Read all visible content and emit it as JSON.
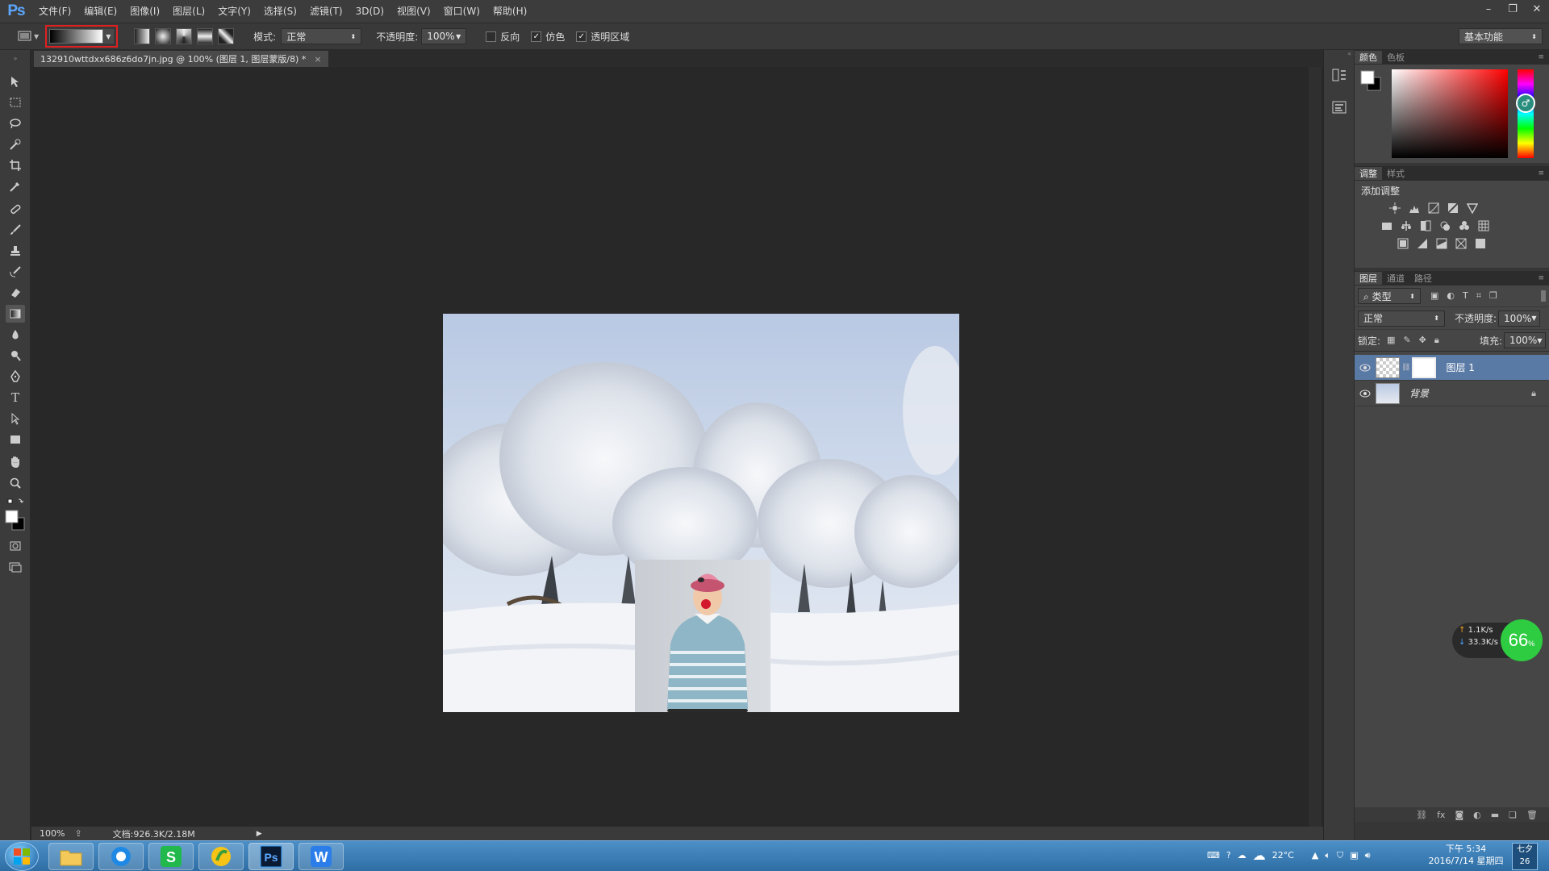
{
  "app": {
    "logo": "Ps"
  },
  "menu": [
    "文件(F)",
    "编辑(E)",
    "图像(I)",
    "图层(L)",
    "文字(Y)",
    "选择(S)",
    "滤镜(T)",
    "3D(D)",
    "视图(V)",
    "窗口(W)",
    "帮助(H)"
  ],
  "options": {
    "mode_label": "模式:",
    "mode_value": "正常",
    "opacity_label": "不透明度:",
    "opacity_value": "100%",
    "reverse_label": "反向",
    "dither_label": "仿色",
    "transparency_label": "透明区域",
    "reverse_checked": false,
    "dither_checked": true,
    "transparency_checked": true,
    "workspace": "基本功能"
  },
  "document": {
    "tab_title": "132910wttdxx686z6do7jn.jpg @ 100% (图层 1, 图层蒙版/8) *",
    "tab_close": "×",
    "zoom": "100%",
    "doc_info": "文档:926.3K/2.18M"
  },
  "panels": {
    "color_tabs": [
      "颜色",
      "色板"
    ],
    "adjust_tabs": [
      "调整",
      "样式"
    ],
    "adjust_title": "添加调整",
    "layers_tabs": [
      "图层",
      "通道",
      "路径"
    ],
    "filter_kind": "类型",
    "blend_mode": "正常",
    "opacity_label": "不透明度:",
    "opacity_value": "100%",
    "lock_label": "锁定:",
    "fill_label": "填充:",
    "fill_value": "100%",
    "layers": [
      {
        "name": "图层 1",
        "selected": true
      },
      {
        "name": "背景",
        "selected": false
      }
    ]
  },
  "netmon": {
    "up": "1.1K/s",
    "down": "33.3K/s",
    "percent": "66",
    "percent_sign": "%"
  },
  "taskbar": {
    "temperature": "22°C",
    "time": "下午 5:34",
    "date": "2016/7/14 星期四",
    "badge_top": "七夕",
    "badge_bottom": "26"
  },
  "colors": {
    "accent_red": "#e02020",
    "selected_layer": "#5a7aa6",
    "taskbar": "#2e6ea5"
  }
}
